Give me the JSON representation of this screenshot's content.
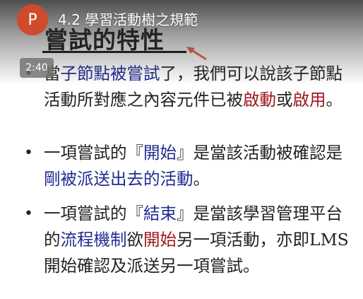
{
  "player": {
    "channel_initial": "P",
    "title": "4.2 學習活動樹之規範",
    "timestamp": "2:40"
  },
  "slide": {
    "heading": "嘗試的特性",
    "bullets": [
      {
        "parts": [
          {
            "text": "當",
            "color": "dark"
          },
          {
            "text": "子節點被嘗試",
            "color": "blue"
          },
          {
            "text": "了，我們可以說該子節點活動所對應之內容元件已被",
            "color": "dark"
          },
          {
            "text": "啟動",
            "color": "red"
          },
          {
            "text": "或",
            "color": "dark"
          },
          {
            "text": "啟用",
            "color": "red"
          },
          {
            "text": "。",
            "color": "dark"
          }
        ]
      },
      {
        "parts": [
          {
            "text": "一項嘗試的『",
            "color": "dark"
          },
          {
            "text": "開始",
            "color": "blue"
          },
          {
            "text": "』是當該活動被確認是",
            "color": "dark"
          },
          {
            "text": "剛被派送出去的活動",
            "color": "blue"
          },
          {
            "text": "。",
            "color": "dark"
          }
        ]
      },
      {
        "parts": [
          {
            "text": "一項嘗試的『",
            "color": "dark"
          },
          {
            "text": "結束",
            "color": "blue"
          },
          {
            "text": "』是當該學習管理平台的",
            "color": "dark"
          },
          {
            "text": "流程機制",
            "color": "blue"
          },
          {
            "text": "欲",
            "color": "dark"
          },
          {
            "text": "開始",
            "color": "red"
          },
          {
            "text": "另一項活動，亦即LMS開始確認及派送另一項嘗試。",
            "color": "dark"
          }
        ]
      }
    ]
  }
}
